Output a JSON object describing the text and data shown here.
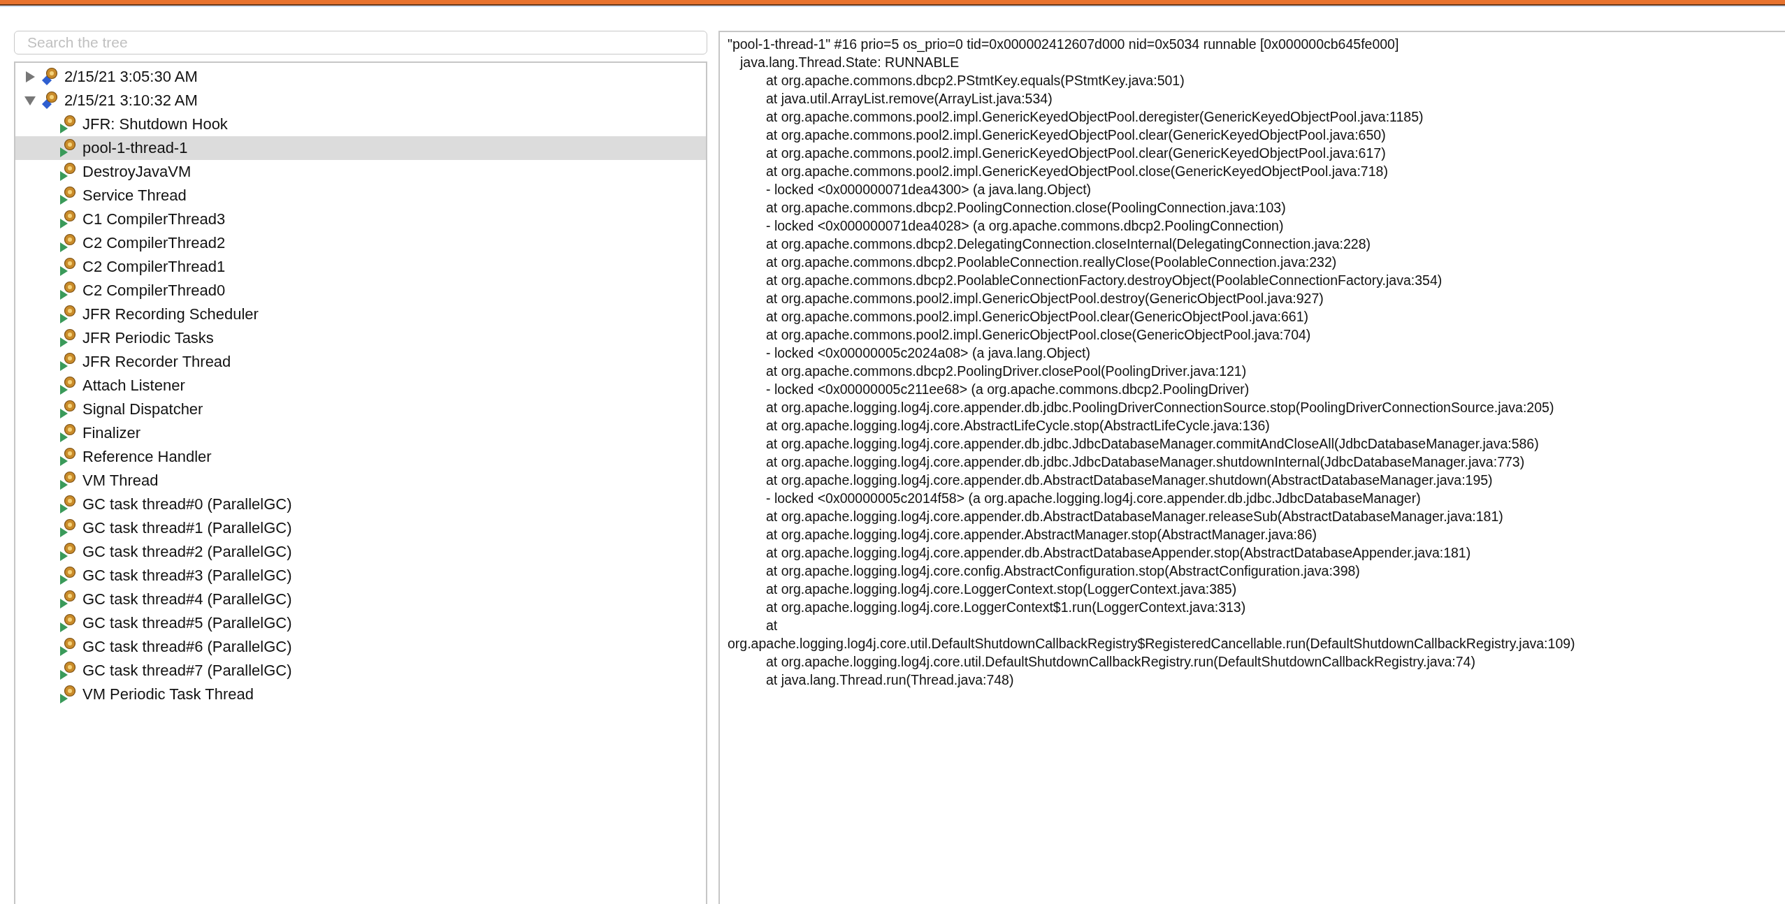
{
  "search": {
    "placeholder": "Search the tree"
  },
  "tree": [
    {
      "label": "2/15/21 3:05:30 AM",
      "expanded": false,
      "selected": false
    },
    {
      "label": "2/15/21 3:10:32 AM",
      "expanded": true,
      "selected": false,
      "children": [
        {
          "label": "JFR: Shutdown Hook",
          "selected": false
        },
        {
          "label": "pool-1-thread-1",
          "selected": true
        },
        {
          "label": "DestroyJavaVM",
          "selected": false
        },
        {
          "label": "Service Thread",
          "selected": false
        },
        {
          "label": "C1 CompilerThread3",
          "selected": false
        },
        {
          "label": "C2 CompilerThread2",
          "selected": false
        },
        {
          "label": "C2 CompilerThread1",
          "selected": false
        },
        {
          "label": "C2 CompilerThread0",
          "selected": false
        },
        {
          "label": "JFR Recording Scheduler",
          "selected": false
        },
        {
          "label": "JFR Periodic Tasks",
          "selected": false
        },
        {
          "label": "JFR Recorder Thread",
          "selected": false
        },
        {
          "label": "Attach Listener",
          "selected": false
        },
        {
          "label": "Signal Dispatcher",
          "selected": false
        },
        {
          "label": "Finalizer",
          "selected": false
        },
        {
          "label": "Reference Handler",
          "selected": false
        },
        {
          "label": "VM Thread",
          "selected": false
        },
        {
          "label": "GC task thread#0 (ParallelGC)",
          "selected": false
        },
        {
          "label": "GC task thread#1 (ParallelGC)",
          "selected": false
        },
        {
          "label": "GC task thread#2 (ParallelGC)",
          "selected": false
        },
        {
          "label": "GC task thread#3 (ParallelGC)",
          "selected": false
        },
        {
          "label": "GC task thread#4 (ParallelGC)",
          "selected": false
        },
        {
          "label": "GC task thread#5 (ParallelGC)",
          "selected": false
        },
        {
          "label": "GC task thread#6 (ParallelGC)",
          "selected": false
        },
        {
          "label": "GC task thread#7 (ParallelGC)",
          "selected": false
        },
        {
          "label": "VM Periodic Task Thread",
          "selected": false
        }
      ]
    }
  ],
  "stack_trace": [
    {
      "kind": "header",
      "text": "\"pool-1-thread-1\" #16 prio=5 os_prio=0 tid=0x000002412607d000 nid=0x5034 runnable [0x000000cb645fe000]"
    },
    {
      "kind": "state",
      "text": "java.lang.Thread.State: RUNNABLE"
    },
    {
      "kind": "frame",
      "text": "at org.apache.commons.dbcp2.PStmtKey.equals(PStmtKey.java:501)"
    },
    {
      "kind": "frame",
      "text": "at java.util.ArrayList.remove(ArrayList.java:534)"
    },
    {
      "kind": "frame",
      "text": "at org.apache.commons.pool2.impl.GenericKeyedObjectPool.deregister(GenericKeyedObjectPool.java:1185)"
    },
    {
      "kind": "frame",
      "text": "at org.apache.commons.pool2.impl.GenericKeyedObjectPool.clear(GenericKeyedObjectPool.java:650)"
    },
    {
      "kind": "frame",
      "text": "at org.apache.commons.pool2.impl.GenericKeyedObjectPool.clear(GenericKeyedObjectPool.java:617)"
    },
    {
      "kind": "frame",
      "text": "at org.apache.commons.pool2.impl.GenericKeyedObjectPool.close(GenericKeyedObjectPool.java:718)"
    },
    {
      "kind": "frame",
      "text": "- locked <0x000000071dea4300> (a java.lang.Object)"
    },
    {
      "kind": "frame",
      "text": "at org.apache.commons.dbcp2.PoolingConnection.close(PoolingConnection.java:103)"
    },
    {
      "kind": "frame",
      "text": "- locked <0x000000071dea4028> (a org.apache.commons.dbcp2.PoolingConnection)"
    },
    {
      "kind": "frame",
      "text": "at org.apache.commons.dbcp2.DelegatingConnection.closeInternal(DelegatingConnection.java:228)"
    },
    {
      "kind": "frame",
      "text": "at org.apache.commons.dbcp2.PoolableConnection.reallyClose(PoolableConnection.java:232)"
    },
    {
      "kind": "frame",
      "text": "at org.apache.commons.dbcp2.PoolableConnectionFactory.destroyObject(PoolableConnectionFactory.java:354)"
    },
    {
      "kind": "frame",
      "text": "at org.apache.commons.pool2.impl.GenericObjectPool.destroy(GenericObjectPool.java:927)"
    },
    {
      "kind": "frame",
      "text": "at org.apache.commons.pool2.impl.GenericObjectPool.clear(GenericObjectPool.java:661)"
    },
    {
      "kind": "frame",
      "text": "at org.apache.commons.pool2.impl.GenericObjectPool.close(GenericObjectPool.java:704)"
    },
    {
      "kind": "frame",
      "text": "- locked <0x00000005c2024a08> (a java.lang.Object)"
    },
    {
      "kind": "frame",
      "text": "at org.apache.commons.dbcp2.PoolingDriver.closePool(PoolingDriver.java:121)"
    },
    {
      "kind": "frame",
      "text": "- locked <0x00000005c211ee68> (a org.apache.commons.dbcp2.PoolingDriver)"
    },
    {
      "kind": "frame",
      "text": "at org.apache.logging.log4j.core.appender.db.jdbc.PoolingDriverConnectionSource.stop(PoolingDriverConnectionSource.java:205)"
    },
    {
      "kind": "frame",
      "text": "at org.apache.logging.log4j.core.AbstractLifeCycle.stop(AbstractLifeCycle.java:136)"
    },
    {
      "kind": "frame",
      "text": "at org.apache.logging.log4j.core.appender.db.jdbc.JdbcDatabaseManager.commitAndCloseAll(JdbcDatabaseManager.java:586)"
    },
    {
      "kind": "frame",
      "text": "at org.apache.logging.log4j.core.appender.db.jdbc.JdbcDatabaseManager.shutdownInternal(JdbcDatabaseManager.java:773)"
    },
    {
      "kind": "frame",
      "text": "at org.apache.logging.log4j.core.appender.db.AbstractDatabaseManager.shutdown(AbstractDatabaseManager.java:195)"
    },
    {
      "kind": "frame",
      "text": "- locked <0x00000005c2014f58> (a org.apache.logging.log4j.core.appender.db.jdbc.JdbcDatabaseManager)"
    },
    {
      "kind": "frame",
      "text": "at org.apache.logging.log4j.core.appender.db.AbstractDatabaseManager.releaseSub(AbstractDatabaseManager.java:181)"
    },
    {
      "kind": "frame",
      "text": "at org.apache.logging.log4j.core.appender.AbstractManager.stop(AbstractManager.java:86)"
    },
    {
      "kind": "frame",
      "text": "at org.apache.logging.log4j.core.appender.db.AbstractDatabaseAppender.stop(AbstractDatabaseAppender.java:181)"
    },
    {
      "kind": "frame",
      "text": "at org.apache.logging.log4j.core.config.AbstractConfiguration.stop(AbstractConfiguration.java:398)"
    },
    {
      "kind": "frame",
      "text": "at org.apache.logging.log4j.core.LoggerContext.stop(LoggerContext.java:385)"
    },
    {
      "kind": "frame",
      "text": "at org.apache.logging.log4j.core.LoggerContext$1.run(LoggerContext.java:313)"
    },
    {
      "kind": "frame",
      "text": "at"
    },
    {
      "kind": "wrapped",
      "text": "org.apache.logging.log4j.core.util.DefaultShutdownCallbackRegistry$RegisteredCancellable.run(DefaultShutdownCallbackRegistry.java:109)"
    },
    {
      "kind": "frame",
      "text": "at org.apache.logging.log4j.core.util.DefaultShutdownCallbackRegistry.run(DefaultShutdownCallbackRegistry.java:74)"
    },
    {
      "kind": "frame",
      "text": "at java.lang.Thread.run(Thread.java:748)"
    }
  ]
}
